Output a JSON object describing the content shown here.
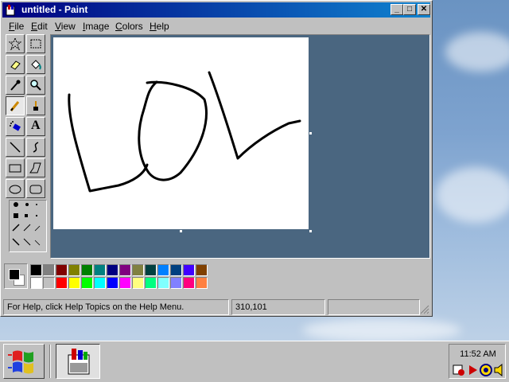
{
  "window": {
    "title": "untitled - Paint",
    "controls": {
      "minimize": "_",
      "maximize": "□",
      "close": "✕"
    }
  },
  "menubar": {
    "items": [
      {
        "label": "File",
        "accel": "F",
        "rest": "ile"
      },
      {
        "label": "Edit",
        "accel": "E",
        "rest": "dit"
      },
      {
        "label": "View",
        "accel": "V",
        "rest": "iew"
      },
      {
        "label": "Image",
        "accel": "I",
        "rest": "mage"
      },
      {
        "label": "Colors",
        "accel": "C",
        "rest": "olors"
      },
      {
        "label": "Help",
        "accel": "H",
        "rest": "elp"
      }
    ]
  },
  "toolbox": {
    "tools": [
      {
        "name": "free-form-select",
        "icon": "star-select-icon"
      },
      {
        "name": "select",
        "icon": "rect-select-icon"
      },
      {
        "name": "eraser",
        "icon": "eraser-icon"
      },
      {
        "name": "fill",
        "icon": "paint-bucket-icon"
      },
      {
        "name": "pick-color",
        "icon": "eyedropper-icon"
      },
      {
        "name": "magnifier",
        "icon": "magnifier-icon"
      },
      {
        "name": "pencil",
        "icon": "pencil-icon",
        "active": true
      },
      {
        "name": "brush",
        "icon": "brush-icon"
      },
      {
        "name": "airbrush",
        "icon": "airbrush-icon"
      },
      {
        "name": "text",
        "icon": "text-icon",
        "glyph": "A"
      },
      {
        "name": "line",
        "icon": "line-icon"
      },
      {
        "name": "curve",
        "icon": "curve-icon"
      },
      {
        "name": "rectangle",
        "icon": "rectangle-icon"
      },
      {
        "name": "polygon",
        "icon": "polygon-icon"
      },
      {
        "name": "ellipse",
        "icon": "ellipse-icon"
      },
      {
        "name": "rounded-rectangle",
        "icon": "rounded-rect-icon"
      }
    ]
  },
  "palette": {
    "foreground": "#000000",
    "background": "#ffffff",
    "colors_top": [
      "#000000",
      "#808080",
      "#800000",
      "#808000",
      "#008000",
      "#008080",
      "#000080",
      "#800080",
      "#808040",
      "#004040",
      "#0080ff",
      "#004080",
      "#4000ff",
      "#804000"
    ],
    "colors_bottom": [
      "#ffffff",
      "#c0c0c0",
      "#ff0000",
      "#ffff00",
      "#00ff00",
      "#00ffff",
      "#0000ff",
      "#ff00ff",
      "#ffff80",
      "#00ff80",
      "#80ffff",
      "#8080ff",
      "#ff0080",
      "#ff8040"
    ]
  },
  "statusbar": {
    "help_text": "For Help, click Help Topics on the Help Menu.",
    "coordinates": "310,101",
    "size": ""
  },
  "taskbar": {
    "clock": "11:52 AM"
  }
}
